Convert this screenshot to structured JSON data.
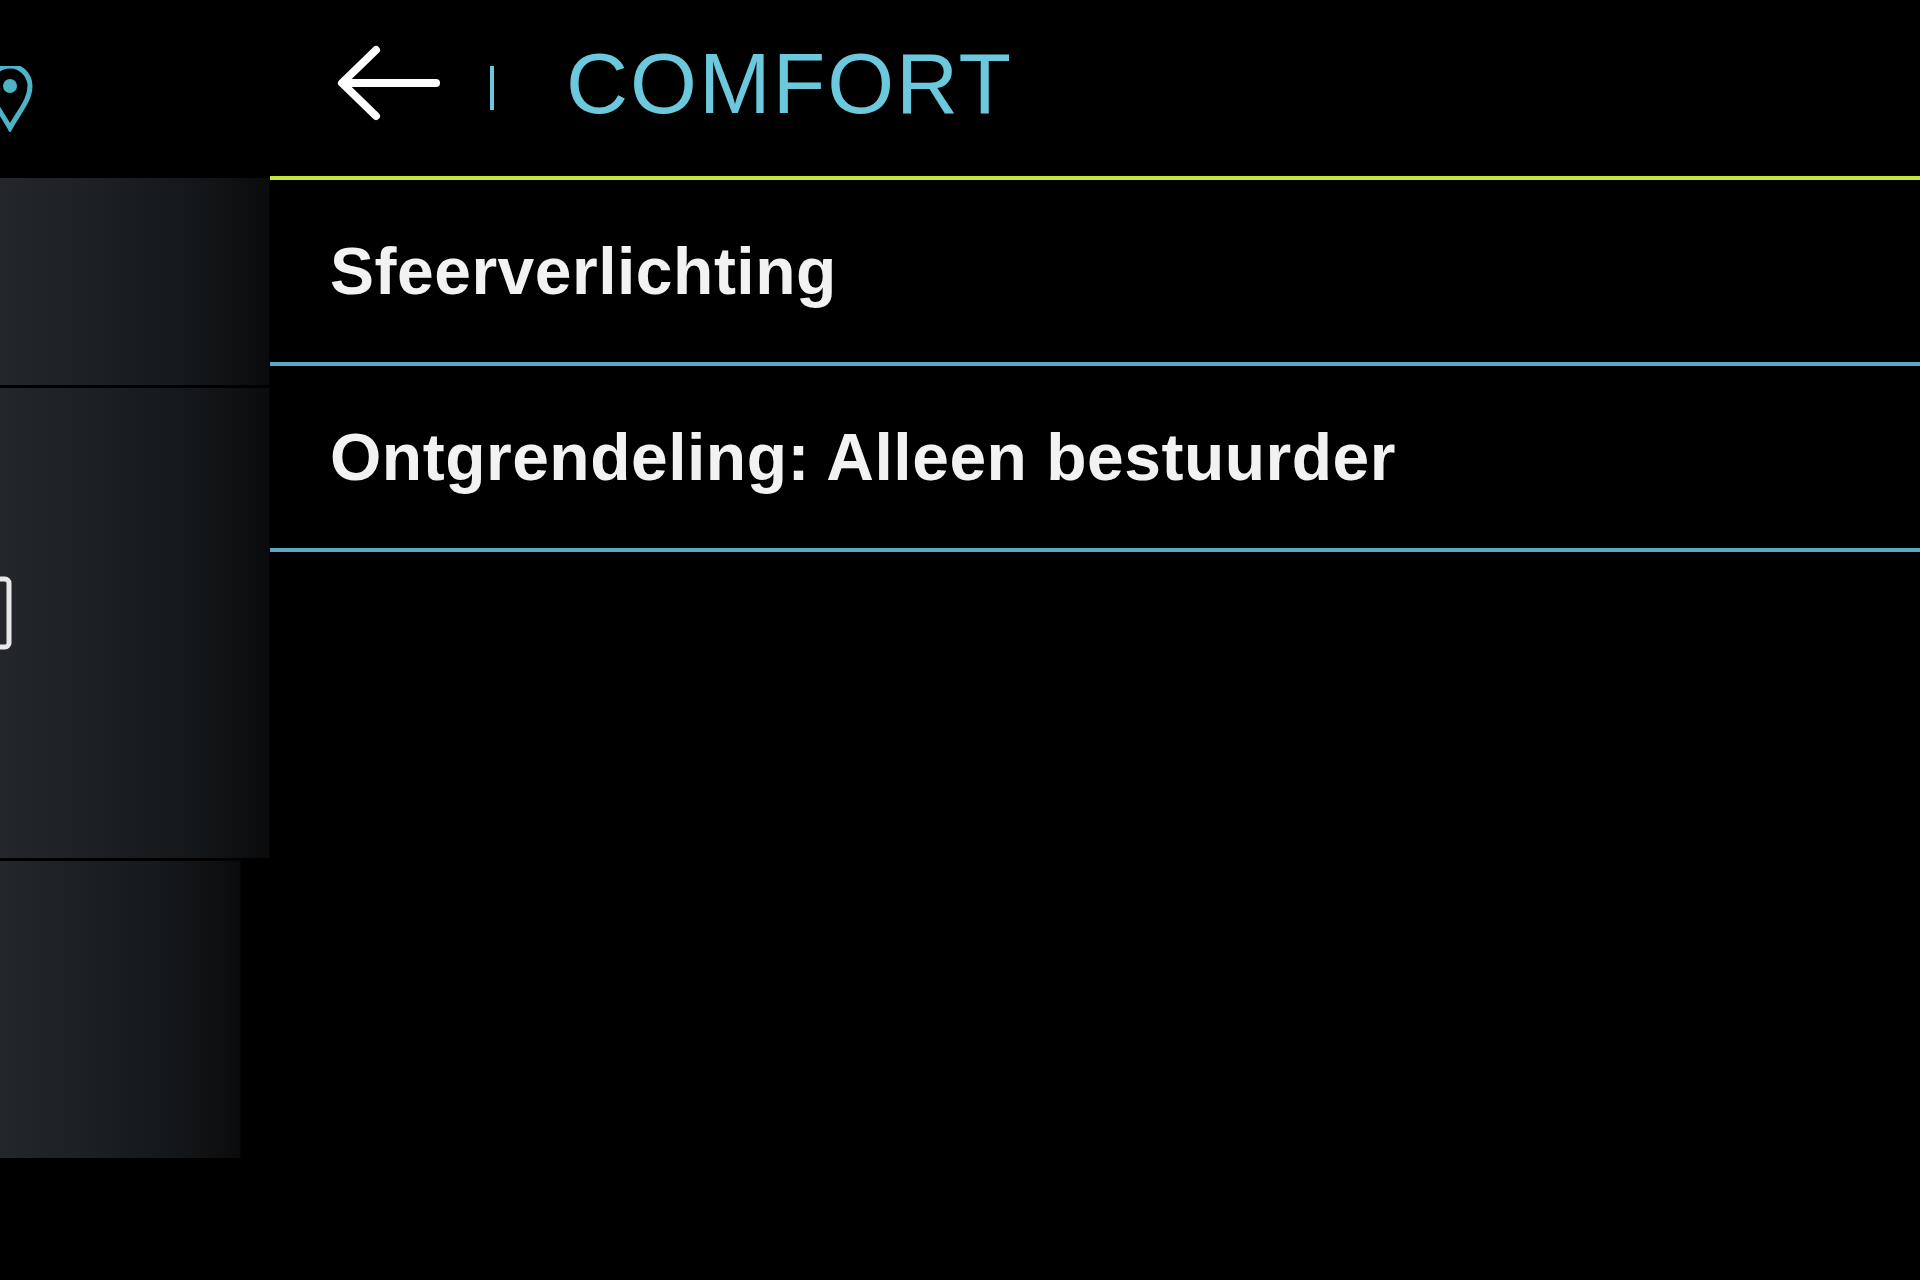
{
  "header": {
    "title": "COMFORT"
  },
  "menu": {
    "items": [
      {
        "label": "Sfeerverlichting"
      },
      {
        "label": "Ontgrendeling: Alleen bestuurder"
      }
    ]
  }
}
